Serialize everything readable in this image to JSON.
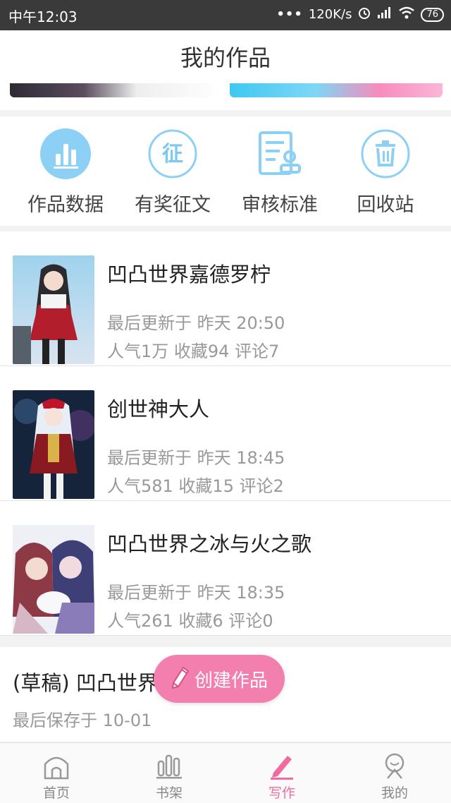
{
  "status_bar": {
    "time": "中午12:03",
    "speed": "120K/s",
    "battery": "76"
  },
  "header": {
    "title": "我的作品"
  },
  "menu": [
    {
      "label": "作品数据",
      "icon": "bar-chart-icon"
    },
    {
      "label": "有奖征文",
      "icon": "contest-icon",
      "glyph": "征"
    },
    {
      "label": "审核标准",
      "icon": "review-standard-icon"
    },
    {
      "label": "回收站",
      "icon": "trash-icon"
    }
  ],
  "works": [
    {
      "title": "凹凸世界嘉德罗柠",
      "updated": "最后更新于 昨天 20:50",
      "stats": "人气1万 收藏94 评论7"
    },
    {
      "title": "创世神大人",
      "updated": "最后更新于 昨天 18:45",
      "stats": "人气581 收藏15 评论2"
    },
    {
      "title": "凹凸世界之冰与火之歌",
      "updated": "最后更新于 昨天 18:35",
      "stats": "人气261 收藏6 评论0"
    }
  ],
  "draft": {
    "title": "(草稿) 凹凸世界",
    "saved": "最后保存于 10-01"
  },
  "create_button": {
    "label": "创建作品"
  },
  "bottom_nav": [
    {
      "label": "首页",
      "icon": "home-icon"
    },
    {
      "label": "书架",
      "icon": "bookshelf-icon"
    },
    {
      "label": "写作",
      "icon": "pen-icon",
      "active": true
    },
    {
      "label": "我的",
      "icon": "profile-icon"
    }
  ],
  "colors": {
    "accent": "#f16aa0",
    "menu_icon": "#7cc8f2"
  }
}
